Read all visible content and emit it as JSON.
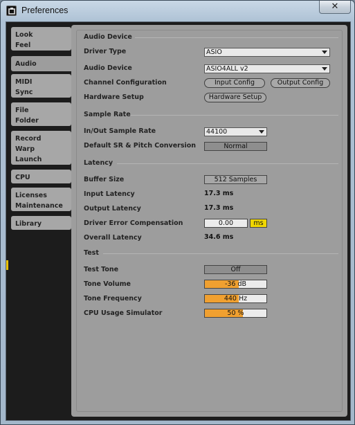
{
  "window": {
    "title": "Preferences",
    "close_glyph": "✕"
  },
  "sidebar": {
    "tabs": [
      {
        "lines": [
          "Look",
          "Feel"
        ]
      },
      {
        "lines": [
          "Audio"
        ],
        "active": true
      },
      {
        "lines": [
          "MIDI",
          "Sync"
        ]
      },
      {
        "lines": [
          "File",
          "Folder"
        ]
      },
      {
        "lines": [
          "Record",
          "Warp",
          "Launch"
        ]
      },
      {
        "lines": [
          "CPU"
        ]
      },
      {
        "lines": [
          "Licenses",
          "Maintenance"
        ]
      },
      {
        "lines": [
          "Library"
        ]
      }
    ]
  },
  "audio_device": {
    "section_title": "Audio Device",
    "driver_type_label": "Driver Type",
    "driver_type_value": "ASIO",
    "audio_device_label": "Audio Device",
    "audio_device_value": "ASIO4ALL v2",
    "channel_config_label": "Channel Configuration",
    "input_config_button": "Input Config",
    "output_config_button": "Output Config",
    "hardware_setup_label": "Hardware Setup",
    "hardware_setup_button": "Hardware Setup"
  },
  "sample_rate": {
    "section_title": "Sample Rate",
    "inout_label": "In/Out Sample Rate",
    "inout_value": "44100",
    "default_sr_label": "Default SR & Pitch Conversion",
    "default_sr_value": "Normal"
  },
  "latency": {
    "section_title": "Latency",
    "buffer_size_label": "Buffer Size",
    "buffer_size_value": "512 Samples",
    "input_latency_label": "Input Latency",
    "input_latency_value": "17.3 ms",
    "output_latency_label": "Output Latency",
    "output_latency_value": "17.3 ms",
    "driver_error_label": "Driver Error Compensation",
    "driver_error_value": "0.00",
    "driver_error_unit": "ms",
    "overall_latency_label": "Overall Latency",
    "overall_latency_value": "34.6 ms"
  },
  "test": {
    "section_title": "Test",
    "test_tone_label": "Test Tone",
    "test_tone_value": "Off",
    "tone_volume_label": "Tone Volume",
    "tone_volume_value": "-36 dB",
    "tone_volume_fill": 0.55,
    "tone_frequency_label": "Tone Frequency",
    "tone_frequency_value": "440 Hz",
    "tone_frequency_fill": 0.55,
    "cpu_sim_label": "CPU Usage Simulator",
    "cpu_sim_value": "50 %",
    "cpu_sim_fill": 0.62
  },
  "colors": {
    "accent_yellow": "#f0d700",
    "slider_orange": "#f0a030",
    "panel_grey": "#9d9d9d"
  }
}
